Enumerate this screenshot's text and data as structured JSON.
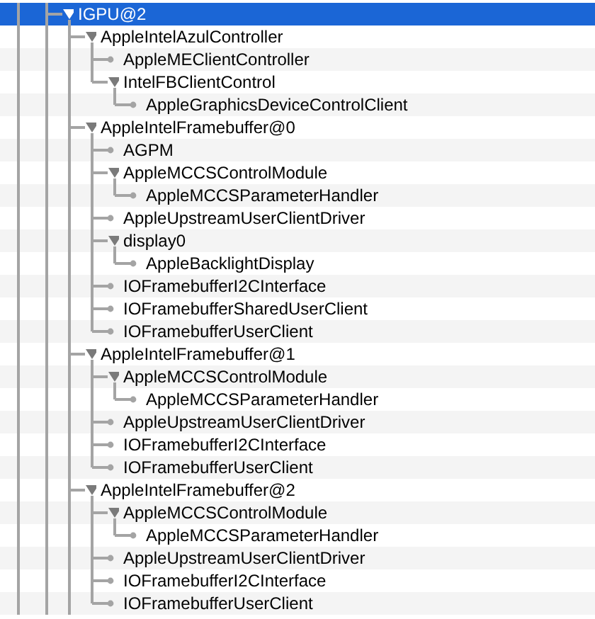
{
  "tree": [
    {
      "label": "IGPU@2",
      "selected": true,
      "expanded": true,
      "children": [
        {
          "label": "AppleIntelAzulController",
          "selected": false,
          "expanded": true,
          "children": [
            {
              "label": "AppleMEClientController",
              "selected": false
            },
            {
              "label": "IntelFBClientControl",
              "selected": false,
              "expanded": true,
              "children": [
                {
                  "label": "AppleGraphicsDeviceControlClient",
                  "selected": false
                }
              ]
            }
          ]
        },
        {
          "label": "AppleIntelFramebuffer@0",
          "selected": false,
          "expanded": true,
          "children": [
            {
              "label": "AGPM",
              "selected": false
            },
            {
              "label": "AppleMCCSControlModule",
              "selected": false,
              "expanded": true,
              "children": [
                {
                  "label": "AppleMCCSParameterHandler",
                  "selected": false
                }
              ]
            },
            {
              "label": "AppleUpstreamUserClientDriver",
              "selected": false
            },
            {
              "label": "display0",
              "selected": false,
              "expanded": true,
              "children": [
                {
                  "label": "AppleBacklightDisplay",
                  "selected": false
                }
              ]
            },
            {
              "label": "IOFramebufferI2CInterface",
              "selected": false
            },
            {
              "label": "IOFramebufferSharedUserClient",
              "selected": false
            },
            {
              "label": "IOFramebufferUserClient",
              "selected": false
            }
          ]
        },
        {
          "label": "AppleIntelFramebuffer@1",
          "selected": false,
          "expanded": true,
          "children": [
            {
              "label": "AppleMCCSControlModule",
              "selected": false,
              "expanded": true,
              "children": [
                {
                  "label": "AppleMCCSParameterHandler",
                  "selected": false
                }
              ]
            },
            {
              "label": "AppleUpstreamUserClientDriver",
              "selected": false
            },
            {
              "label": "IOFramebufferI2CInterface",
              "selected": false
            },
            {
              "label": "IOFramebufferUserClient",
              "selected": false
            }
          ]
        },
        {
          "label": "AppleIntelFramebuffer@2",
          "selected": false,
          "expanded": true,
          "children": [
            {
              "label": "AppleMCCSControlModule",
              "selected": false,
              "expanded": true,
              "children": [
                {
                  "label": "AppleMCCSParameterHandler",
                  "selected": false
                }
              ]
            },
            {
              "label": "AppleUpstreamUserClientDriver",
              "selected": false
            },
            {
              "label": "IOFramebufferI2CInterface",
              "selected": false
            },
            {
              "label": "IOFramebufferUserClient",
              "selected": false
            }
          ]
        }
      ]
    }
  ]
}
